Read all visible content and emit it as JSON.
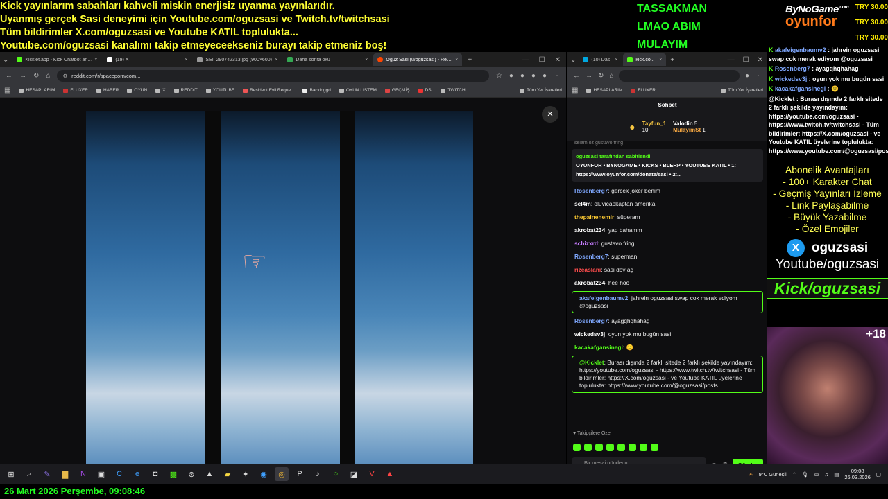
{
  "overlay": {
    "banner_lines": [
      "Kick yayınlarım sabahları kahveli miskin enerjisiz uyanma yayınlarıdır.",
      "Uyanmış gerçek Sasi deneyimi için Youtube.com/oguzsasi ve Twitch.tv/twitchsasi",
      "Tüm bildirimler X.com/oguzsasi ve Youtube KATIL toplulukta...",
      "Youtube.com/oguzsasi kanalımı takip etmeyeceekseniz burayı takip etmeniz boş!"
    ],
    "goals": [
      "TASSAKMAN",
      "LMAO ABIM",
      "MULAYIM"
    ],
    "logo_top": "ByNoGame",
    "logo_bottom": "oyunfor",
    "logo_sup": ".com",
    "donations": [
      "TRY 30.00",
      "TRY 30.00",
      "TRY 30.00"
    ],
    "date_line": "26 Mart 2026 Perşembe, 09:08:46"
  },
  "browser1": {
    "tabs": [
      {
        "title": "Kicklet.app - Kick Chatbot and...",
        "color": "#53fc18"
      },
      {
        "title": "(19) X",
        "color": "#ffffff"
      },
      {
        "title": "SEI_290742313.jpg (900×600)",
        "color": "#999999"
      },
      {
        "title": "Daha sonra oku",
        "color": "#34a853"
      },
      {
        "title": "Oğuz Sasi (u/oguzsasi) - Reddit",
        "color": "#ff4500"
      }
    ],
    "new_tab": "+",
    "url": "reddit.com/r/spaceporn/com...",
    "bookmarks": [
      "HESAPLARIM",
      "FLUXER",
      "HABER",
      "OYUN",
      "X",
      "REDDIT",
      "YOUTUBE",
      "Resident Evil Reque...",
      "Backloggd",
      "OYUN LISTEM",
      "GEÇMİŞ",
      "DSİ",
      "TWITCH"
    ],
    "all_bookmarks": "Tüm Yer İşaretleri",
    "close_label": "×"
  },
  "browser2": {
    "tabs": [
      {
        "title": "(10) Das",
        "color": "#00a8e0"
      },
      {
        "title": "kick.co...",
        "color": "#53fc18"
      }
    ],
    "bookmarks": [
      "HESAPLARIM",
      "FLUXER"
    ],
    "all_bookmarks": "Tüm Yer İşaretleri",
    "chat_title": "Sohbet",
    "leaderboard": [
      {
        "name": "Tayfun_1",
        "score": "10"
      },
      {
        "name": "Valodin",
        "score": "5"
      },
      {
        "name": "MulayimSt",
        "score": "1"
      }
    ],
    "top_cut": "selam oz gustavo fring",
    "pinned_by": "oguzsasi tarafından sabitlendi",
    "pinned_text": "OYUNFOR • BYNOGAME • KICKS • BLERP • YOUTUBE KATIL • 1: https://www.oyunfor.com/donate/sasi • 2:...",
    "messages": [
      {
        "user": "Rosenberg7",
        "color": "#7fa8ff",
        "text": "gercek joker benim"
      },
      {
        "user": "sel4m",
        "color": "#ffffff",
        "text": "oluvicapkaptan amerika"
      },
      {
        "user": "thepainenemir",
        "color": "#ffcc33",
        "text": "süperam"
      },
      {
        "user": "akrobat234",
        "color": "#ffffff",
        "text": "yap bahamm"
      },
      {
        "user": "schizxrd",
        "color": "#c77dff",
        "text": "gustavo fring"
      },
      {
        "user": "Rosenberg7",
        "color": "#7fa8ff",
        "text": "superman"
      },
      {
        "user": "rizeaslani",
        "color": "#ff4d4d",
        "text": "sasi döv aç"
      },
      {
        "user": "akrobat234",
        "color": "#ffffff",
        "text": "hee hoo"
      }
    ],
    "highlight1_user": "akafeigenbaumv2",
    "highlight1_text": "jahrein oguzsasi swap cok merak ediyom @oguzsasi",
    "messages2": [
      {
        "user": "Rosenberg7",
        "color": "#7fa8ff",
        "text": "ayagqhqhahag"
      },
      {
        "user": "wickedsv3j",
        "color": "#ffffff",
        "text": "oyun yok mu bugün sasi"
      },
      {
        "user": "kacakafgansinegi",
        "color": "#53fc18",
        "text": "🙂"
      }
    ],
    "bot_user": "@Kicklet",
    "bot_text": "Burası dışında 2 farklı sitede 2 farklı şekilde yayındayım: https://youtube.com/oguzsasi - https://www.twitch.tv/twitchsasi - Tüm bildirimler: https://X.com/oguzsasi - ve Youtube KATIL üyelerine toplulukta: https://www.youtube.com/@oguzsasi/posts",
    "followers_label": "♥ Takipçilere Özel",
    "input_placeholder": "Bir mesaj gönderin",
    "send_label": "Gönder"
  },
  "rightcol": {
    "messages": [
      {
        "user": "akafeigenbaumv2",
        "text": "jahrein oguzsasi swap cok merak ediyom @oguzsasi"
      },
      {
        "user": "Rosenberg7",
        "text": "ayagqhqhahag"
      },
      {
        "user": "wickedsv3j",
        "text": "oyun yok mu bugün sasi"
      },
      {
        "user": "kacakafgansinegi",
        "text": "🙂"
      }
    ],
    "bot": "@Kicklet : Burası dışında 2 farklı sitede 2 farklı şekilde yayındayım: https://youtube.com/oguzsasi - https://www.twitch.tv/twitchsasi - Tüm bildirimler: https://X.com/oguzsasi - ve Youtube KATIL üyelerine toplulukta: https://www.youtube.com/@oguzsasi/posts",
    "abonelik": [
      "Abonelik Avantajları",
      "- 100+ Karakter Chat",
      "- Geçmiş Yayınları İzleme",
      "- Link Paylaşabilme",
      "- Büyük Yazabilme",
      "- Özel Emojiler"
    ],
    "x_handle": "oguzsasi",
    "youtube": "Youtube/oguzsasi",
    "kick": "Kick/oguzsasi",
    "age": "+18"
  },
  "taskbar": {
    "weather": "9°C  Güneşli",
    "time": "09:08",
    "date": "26.03.2026"
  }
}
